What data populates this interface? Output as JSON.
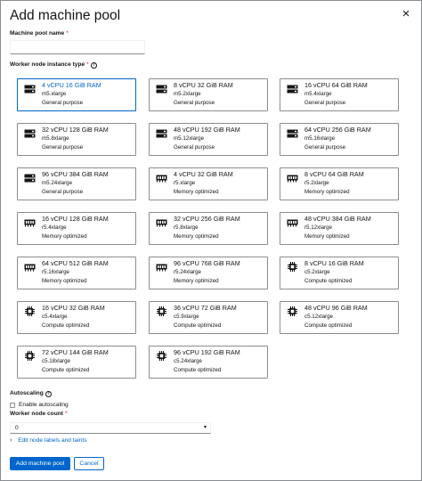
{
  "modal": {
    "title": "Add machine pool",
    "close_symbol": "×"
  },
  "form": {
    "pool_name_label": "Machine pool name",
    "required_mark": "*",
    "pool_name_value": "",
    "instance_type_label": "Worker node instance type",
    "autoscaling_label": "Autoscaling",
    "enable_autoscaling_label": "Enable autoscaling",
    "enable_autoscaling_checked": false,
    "node_count_label": "Worker node count",
    "node_count_value": "0",
    "labels_taints_link": "Edit node labels and taints"
  },
  "instances": [
    {
      "spec": "4 vCPU 16 GiB RAM",
      "type": "m5.xlarge",
      "category": "General purpose",
      "icon": "server-icon",
      "selected": true
    },
    {
      "spec": "8 vCPU 32 GiB RAM",
      "type": "m5.2xlarge",
      "category": "General purpose",
      "icon": "server-icon",
      "selected": false
    },
    {
      "spec": "16 vCPU 64 GiB RAM",
      "type": "m5.4xlarge",
      "category": "General purpose",
      "icon": "server-icon",
      "selected": false
    },
    {
      "spec": "32 vCPU 128 GiB RAM",
      "type": "m5.8xlarge",
      "category": "General purpose",
      "icon": "server-icon",
      "selected": false
    },
    {
      "spec": "48 vCPU 192 GiB RAM",
      "type": "m5.12xlarge",
      "category": "General purpose",
      "icon": "server-icon",
      "selected": false
    },
    {
      "spec": "64 vCPU 256 GiB RAM",
      "type": "m5.16xlarge",
      "category": "General purpose",
      "icon": "server-icon",
      "selected": false
    },
    {
      "spec": "96 vCPU 384 GiB RAM",
      "type": "m5.24xlarge",
      "category": "General purpose",
      "icon": "server-icon",
      "selected": false
    },
    {
      "spec": "4 vCPU 32 GiB RAM",
      "type": "r5.xlarge",
      "category": "Memory optimized",
      "icon": "memory-icon",
      "selected": false
    },
    {
      "spec": "8 vCPU 64 GiB RAM",
      "type": "r5.2xlarge",
      "category": "Memory optimized",
      "icon": "memory-icon",
      "selected": false
    },
    {
      "spec": "16 vCPU 128 GiB RAM",
      "type": "r5.4xlarge",
      "category": "Memory optimized",
      "icon": "memory-icon",
      "selected": false
    },
    {
      "spec": "32 vCPU 256 GiB RAM",
      "type": "r5.8xlarge",
      "category": "Memory optimized",
      "icon": "memory-icon",
      "selected": false
    },
    {
      "spec": "48 vCPU 384 GiB RAM",
      "type": "r5.12xlarge",
      "category": "Memory optimized",
      "icon": "memory-icon",
      "selected": false
    },
    {
      "spec": "64 vCPU 512 GiB RAM",
      "type": "r5.16xlarge",
      "category": "Memory optimized",
      "icon": "memory-icon",
      "selected": false
    },
    {
      "spec": "96 vCPU 768 GiB RAM",
      "type": "r5.24xlarge",
      "category": "Memory optimized",
      "icon": "memory-icon",
      "selected": false
    },
    {
      "spec": "8 vCPU 16 GiB RAM",
      "type": "c5.2xlarge",
      "category": "Compute optimized",
      "icon": "cpu-icon",
      "selected": false
    },
    {
      "spec": "16 vCPU 32 GiB RAM",
      "type": "c5.4xlarge",
      "category": "Compute optimized",
      "icon": "cpu-icon",
      "selected": false
    },
    {
      "spec": "36 vCPU 72 GiB RAM",
      "type": "c5.9xlarge",
      "category": "Compute optimized",
      "icon": "cpu-icon",
      "selected": false
    },
    {
      "spec": "48 vCPU 96 GiB RAM",
      "type": "c5.12xlarge",
      "category": "Compute optimized",
      "icon": "cpu-icon",
      "selected": false
    },
    {
      "spec": "72 vCPU 144 GiB RAM",
      "type": "c5.18xlarge",
      "category": "Compute optimized",
      "icon": "cpu-icon",
      "selected": false
    },
    {
      "spec": "96 vCPU 192 GiB RAM",
      "type": "c5.24xlarge",
      "category": "Compute optimized",
      "icon": "cpu-icon",
      "selected": false
    }
  ],
  "actions": {
    "submit_label": "Add machine pool",
    "cancel_label": "Cancel"
  },
  "colors": {
    "accent": "#0066cc",
    "required": "#c9190b",
    "border": "#8a8d90"
  }
}
